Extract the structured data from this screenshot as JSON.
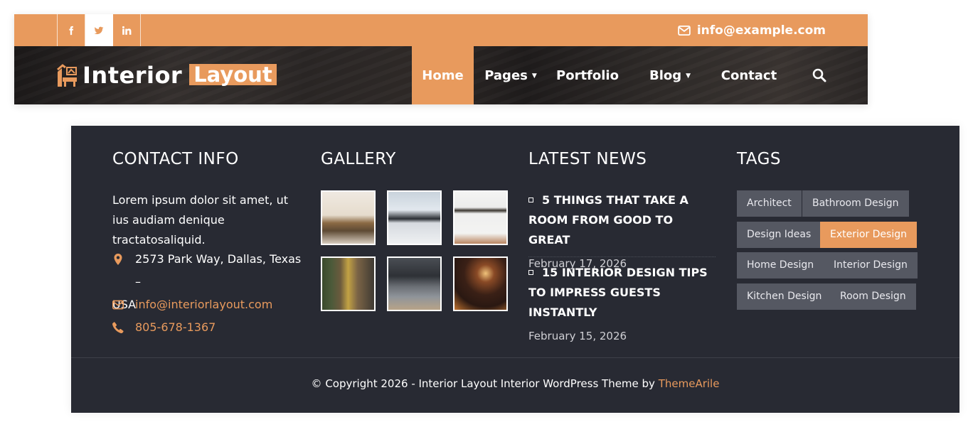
{
  "colors": {
    "accent": "#e89a5d",
    "footer_bg": "#282a33",
    "tag_bg": "#555862"
  },
  "topbar": {
    "social": [
      {
        "icon": "facebook-icon",
        "active": false
      },
      {
        "icon": "twitter-icon",
        "active": true
      },
      {
        "icon": "linkedin-icon",
        "active": false
      }
    ],
    "email": "info@example.com"
  },
  "navbar": {
    "logo_word": "Interior",
    "logo_box": "Layout",
    "items": [
      {
        "label": "Home",
        "caret": false
      },
      {
        "label": "Pages",
        "caret": true
      },
      {
        "label": "Portfolio",
        "caret": false
      },
      {
        "label": "Blog",
        "caret": true
      },
      {
        "label": "Contact",
        "caret": false
      }
    ],
    "search_icon": "search-icon"
  },
  "footer": {
    "contact": {
      "title": "CONTACT INFO",
      "description": "Lorem ipsum dolor sit amet, ut ius audiam denique tractatosaliquid.",
      "address_line1": "2573 Park Way, Dallas, Texas –",
      "address_line2": "USA",
      "email": "info@interiorlayout.com",
      "phone": "805-678-1367"
    },
    "gallery": {
      "title": "GALLERY",
      "images": [
        "dining-room",
        "desk-workspace",
        "white-wall-shelf",
        "living-room-art",
        "tv-lounge",
        "dark-lounge-lamps"
      ]
    },
    "news": {
      "title": "LATEST NEWS",
      "items": [
        {
          "title": "5 THINGS THAT TAKE A ROOM FROM GOOD TO GREAT",
          "date": "February 17, 2026"
        },
        {
          "title": "15 INTERIOR DESIGN TIPS TO IMPRESS GUESTS INSTANTLY",
          "date": "February 15, 2026"
        }
      ]
    },
    "tags": {
      "title": "TAGS",
      "items": [
        {
          "label": "Architect",
          "active": false
        },
        {
          "label": "Bathroom Design",
          "active": false
        },
        {
          "label": "Design Ideas",
          "active": false
        },
        {
          "label": "Exterior Design",
          "active": true
        },
        {
          "label": "Home Design",
          "active": false
        },
        {
          "label": "Interior Design",
          "active": false
        },
        {
          "label": "Kitchen Design",
          "active": false
        },
        {
          "label": "Room Design",
          "active": false
        }
      ]
    },
    "copyright_text": "© Copyright 2026 - Interior Layout Interior WordPress Theme by ",
    "copyright_link": "ThemeArile"
  }
}
